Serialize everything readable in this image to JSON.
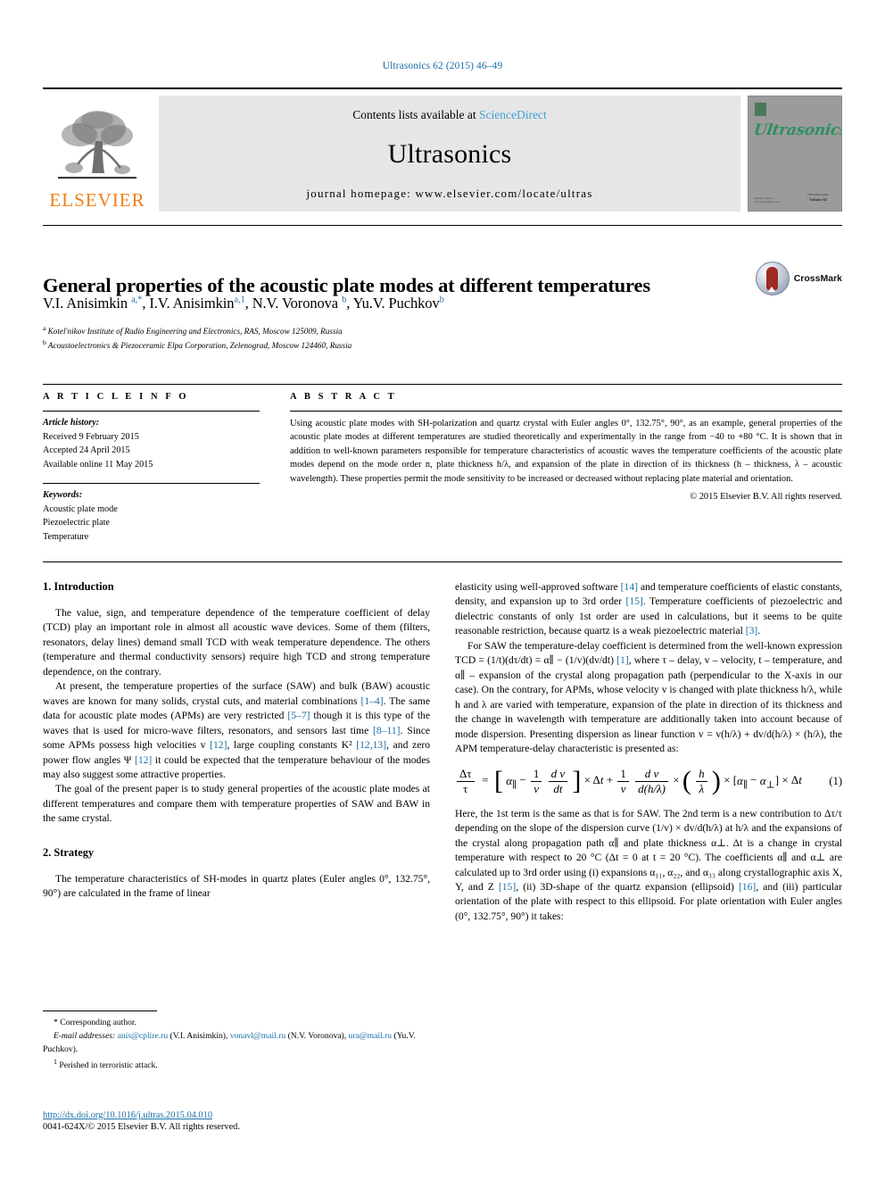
{
  "running_head": "Ultrasonics 62 (2015) 46–49",
  "masthead": {
    "publisher_name": "ELSEVIER",
    "contents_prefix": "Contents lists available at ",
    "sciencedirect": "ScienceDirect",
    "journal_name": "Ultrasonics",
    "homepage": "journal homepage: www.elsevier.com/locate/ultras",
    "cover_title": "Ultrasonics",
    "cover_foot_left": "Available online at www.sciencedirect.com",
    "cover_foot_right_line1": "ISSN 0041-624X",
    "cover_foot_right_line2": "Volume 62"
  },
  "article": {
    "title": "General properties of the acoustic plate modes at different temperatures",
    "crossmark_label": "CrossMark",
    "authors_html": "V.I. Anisimkin <sup>a,*</sup>, I.V. Anisimkin<sup>a,1</sup>, N.V. Voronova <sup>b</sup>, Yu.V. Puchkov<sup>b</sup>",
    "affiliation_a": "Kotel'nikov Institute of Radio Engineering and Electronics, RAS, Moscow 125009, Russia",
    "affiliation_b": "Acoustoelectronics & Piezoceramic Elpa Corporation, Zelenograd, Moscow 124460, Russia"
  },
  "info": {
    "heading": "A R T I C L E    I N F O",
    "history_label": "Article history:",
    "history": [
      "Received 9 February 2015",
      "Accepted 24 April 2015",
      "Available online 11 May 2015"
    ],
    "keywords_label": "Keywords:",
    "keywords": [
      "Acoustic plate mode",
      "Piezoelectric plate",
      "Temperature"
    ]
  },
  "abstract": {
    "heading": "A B S T R A C T",
    "text": "Using acoustic plate modes with SH-polarization and quartz crystal with Euler angles 0°, 132.75°, 90°, as an example, general properties of the acoustic plate modes at different temperatures are studied theoretically and experimentally in the range from −40 to +80 °C. It is shown that in addition to well-known parameters responsible for temperature characteristics of acoustic waves the temperature coefficients of the acoustic plate modes depend on the mode order n, plate thickness h/λ, and expansion of the plate in direction of its thickness (h – thickness, λ – acoustic wavelength). These properties permit the mode sensitivity to be increased or decreased without replacing plate material and orientation.",
    "copyright": "© 2015 Elsevier B.V. All rights reserved."
  },
  "body": {
    "left": {
      "section1_heading": "1. Introduction",
      "p1": "The value, sign, and temperature dependence of the temperature coefficient of delay (TCD) play an important role in almost all acoustic wave devices. Some of them (filters, resonators, delay lines) demand small TCD with weak temperature dependence. The others (temperature and thermal conductivity sensors) require high TCD and strong temperature dependence, on the contrary.",
      "p2_parts": {
        "a": "At present, the temperature properties of the surface (SAW) and bulk (BAW) acoustic waves are known for many solids, crystal cuts, and material combinations ",
        "r1": "[1–4]",
        "b": ". The same data for acoustic plate modes (APMs) are very restricted ",
        "r2": "[5–7]",
        "c": " though it is this type of the waves that is used for micro-wave filters, resonators, and sensors last time ",
        "r3": "[8–11]",
        "d": ". Since some APMs possess high velocities v ",
        "r4": "[12]",
        "e": ", large coupling constants K² ",
        "r5": "[12,13]",
        "f": ", and zero power flow angles Ψ ",
        "r6": "[12]",
        "g": " it could be expected that the temperature behaviour of the modes may also suggest some attractive properties."
      },
      "p3": "The goal of the present paper is to study general properties of the acoustic plate modes at different temperatures and compare them with temperature properties of SAW and BAW in the same crystal.",
      "section2_heading": "2. Strategy",
      "p4": "The temperature characteristics of SH-modes in quartz plates (Euler angles 0°, 132.75°, 90°) are calculated in the frame of linear"
    },
    "right": {
      "p1_parts": {
        "a": "elasticity using well-approved software ",
        "r1": "[14]",
        "b": " and temperature coefficients of elastic constants, density, and expansion up to 3rd order ",
        "r2": "[15]",
        "c": ". Temperature coefficients of piezoelectric and dielectric constants of only 1st order are used in calculations, but it seems to be quite reasonable restriction, because quartz is a weak piezoelectric material ",
        "r3": "[3]",
        "d": "."
      },
      "p2_parts": {
        "a": "For SAW the temperature-delay coefficient is determined from the well-known expression TCD = (1/t)(dτ/dt) = α∥ − (1/v)(dv/dt) ",
        "r1": "[1]",
        "b": ", where τ – delay, v – velocity, t – temperature, and α∥ – expansion of the crystal along propagation path (perpendicular to the X-axis in our case). On the contrary, for APMs, whose velocity v is changed with plate thickness h/λ, while h and λ are varied with temperature, expansion of the plate in direction of its thickness and the change in wavelength with temperature are additionally taken into account because of mode dispersion. Presenting dispersion as linear function v = v(h/λ) + dv/d(h/λ) × (h/λ), the APM temperature-delay characteristic is presented as:"
      },
      "equation": {
        "number": "(1)",
        "lhs_num": "Δτ",
        "lhs_den": "τ",
        "text": "Δτ/τ = [α∥ − (1/v)(dv/dt)] × Δt + (1/v)(dv/d(h/λ)) × (h/λ) × [α∥ − α⊥] × Δt"
      },
      "p3_parts": {
        "a": "Here, the 1st term is the same as that is for SAW. The 2nd term is a new contribution to Δτ/τ depending on the slope of the dispersion curve (1/v) × dv/d(h/λ) at h/λ and the expansions of the crystal along propagation path α∥ and plate thickness α⊥. Δt is a change in crystal temperature with respect to 20 °C (Δt = 0 at t = 20 °C). The coefficients α∥ and α⊥ are calculated up to 3rd order using (i) expansions α₁₁, α₂₂, and α₃₃ along crystallographic axis X, Y, and Z ",
        "r1": "[15]",
        "b": ", (ii) 3D-shape of the quartz expansion (ellipsoid) ",
        "r2": "[16]",
        "c": ", and (iii) particular orientation of the plate with respect to this ellipsoid. For plate orientation with Euler angles (0°, 132.75°, 90°) it takes:"
      }
    }
  },
  "footnotes": {
    "corresponding": "* Corresponding author.",
    "email_label": "E-mail addresses:",
    "email1": "anis@cplire.ru",
    "email1_who": " (V.I. Anisimkin), ",
    "email2": "vonavl@mail.ru",
    "email2_who": " (N.V. Voronova), ",
    "email3": "ura@mail.ru",
    "email3_who": " (Yu.V. Puchkov).",
    "perished": "Perished in terroristic attack.",
    "perished_marker": "1"
  },
  "doi": {
    "url": "http://dx.doi.org/10.1016/j.ultras.2015.04.010",
    "issn_line": "0041-624X/© 2015 Elsevier B.V. All rights reserved."
  },
  "colors": {
    "link_blue": "#1a6ea8",
    "sciencedirect_blue": "#3ea3d8",
    "elsevier_orange": "#F07F1A",
    "cover_gray": "#9b9b9b",
    "banner_gray": "#e6e6e6"
  }
}
